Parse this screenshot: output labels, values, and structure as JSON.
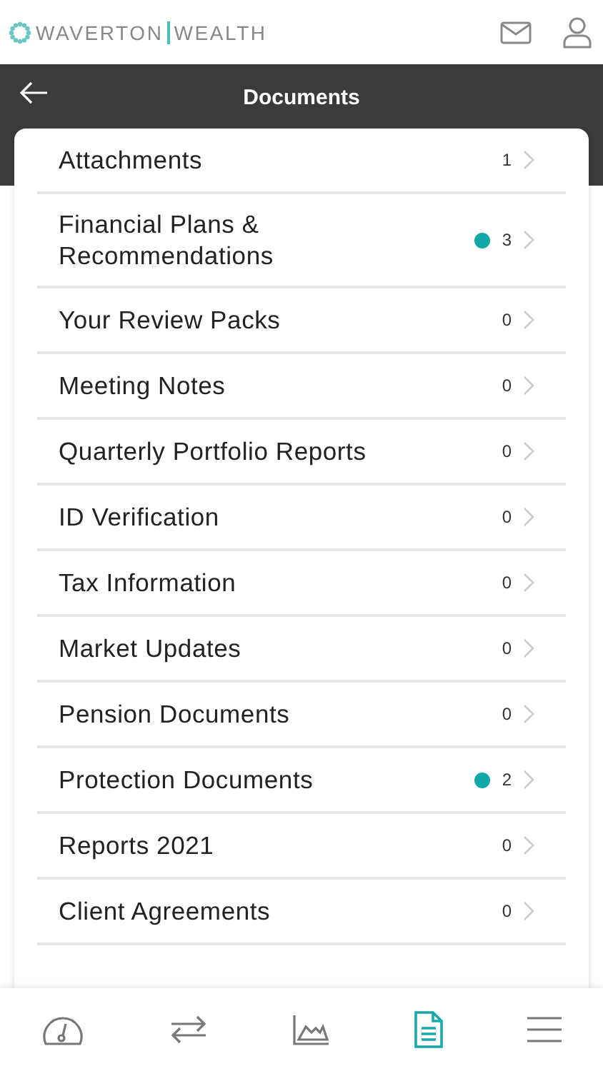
{
  "brand": {
    "name_left": "WAVERTON",
    "name_right": "WEALTH"
  },
  "title_bar": {
    "title": "Documents"
  },
  "documents": [
    {
      "label": "Attachments",
      "count": "1",
      "unread": false
    },
    {
      "label": "Financial Plans & Recommendations",
      "count": "3",
      "unread": true
    },
    {
      "label": "Your Review Packs",
      "count": "0",
      "unread": false
    },
    {
      "label": "Meeting Notes",
      "count": "0",
      "unread": false
    },
    {
      "label": "Quarterly Portfolio Reports",
      "count": "0",
      "unread": false
    },
    {
      "label": "ID Verification",
      "count": "0",
      "unread": false
    },
    {
      "label": "Tax Information",
      "count": "0",
      "unread": false
    },
    {
      "label": "Market Updates",
      "count": "0",
      "unread": false
    },
    {
      "label": "Pension Documents",
      "count": "0",
      "unread": false
    },
    {
      "label": "Protection Documents",
      "count": "2",
      "unread": true
    },
    {
      "label": "Reports 2021",
      "count": "0",
      "unread": false
    },
    {
      "label": "Client Agreements",
      "count": "0",
      "unread": false
    }
  ],
  "bottom_nav": [
    {
      "kind": "dashboard",
      "selected": false
    },
    {
      "kind": "transfers",
      "selected": false
    },
    {
      "kind": "performance",
      "selected": false
    },
    {
      "kind": "documents",
      "selected": true
    },
    {
      "kind": "menu",
      "selected": false
    }
  ]
}
